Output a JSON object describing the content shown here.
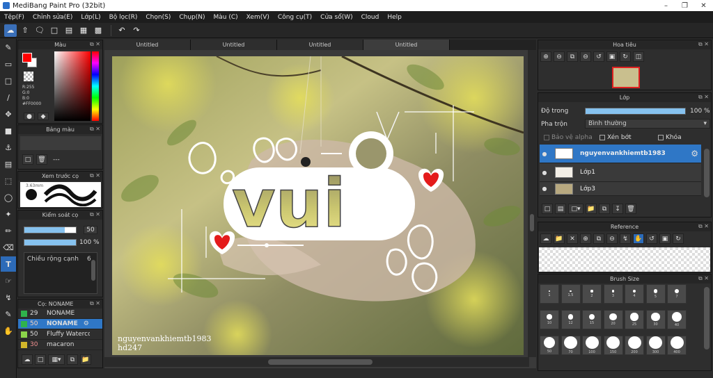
{
  "window": {
    "title": "MediBang Paint Pro (32bit)"
  },
  "menu": [
    "Tệp(F)",
    "Chỉnh sửa(E)",
    "Lớp(L)",
    "Bộ lọc(R)",
    "Chọn(S)",
    "Chụp(N)",
    "Màu (C)",
    "Xem(V)",
    "Công cụ(T)",
    "Cửa sổ(W)",
    "Cloud",
    "Help"
  ],
  "tabs": [
    "Untitled",
    "Untitled",
    "Untitled",
    "Untitled"
  ],
  "color_panel": {
    "title": "Màu",
    "r": "R:255",
    "g": "G:0",
    "b": "B:0",
    "hex": "#FF0000",
    "fg": "#ff0000",
    "bg": "#ffffff"
  },
  "palette_panel": {
    "title": "Bảng màu",
    "dash": "---"
  },
  "preview_panel": {
    "title": "Xem trước cọ",
    "size": "3.63mm"
  },
  "brush_control": {
    "title": "Kiểm soát cọ",
    "size_value": "50",
    "opacity_value": "100 %",
    "width_label": "Chiều rộng cạnh",
    "width_value": "6"
  },
  "brush_list": {
    "title": "Cọ: NONAME",
    "items": [
      {
        "size": "29",
        "name": "NONAME",
        "color": "#2fb24c"
      },
      {
        "size": "50",
        "name": "NONAME",
        "color": "#2fb24c"
      },
      {
        "size": "50",
        "name": "Fluffy Watercol",
        "color": "#8bd44a"
      },
      {
        "size": "30",
        "name": "macaron",
        "color": "#d2b62a"
      }
    ]
  },
  "navigator": {
    "title": "Hoa tiêu"
  },
  "layer_panel": {
    "title": "Lớp",
    "opacity_label": "Độ trong",
    "opacity_value": "100 %",
    "opacity_fraction": 1.0,
    "blend_label": "Pha trộn",
    "blend_value": "Bình thường",
    "protect_alpha": "Bảo vệ alpha",
    "clipping": "Xén bớt",
    "lock": "Khóa",
    "layers": [
      "nguyenvankhiemtb1983",
      "Lớp1",
      "Lớp3"
    ]
  },
  "reference": {
    "title": "Reference"
  },
  "brush_size": {
    "title": "Brush Size",
    "sizes": [
      "1",
      "1.5",
      "2",
      "3",
      "4",
      "5",
      "7",
      "10",
      "12",
      "15",
      "20",
      "25",
      "30",
      "40",
      "50",
      "70",
      "100",
      "150",
      "200",
      "300",
      "400"
    ]
  },
  "canvas": {
    "line1": "nguyenvankhiemtb1983",
    "line2": "hd247",
    "art_text": "vui"
  }
}
